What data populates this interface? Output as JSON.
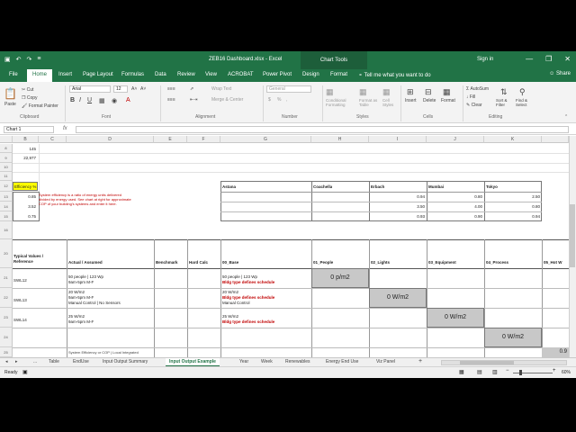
{
  "window": {
    "title": "ZEB16 Dashboard.xlsx - Excel",
    "context_tab": "Chart Tools",
    "sign_in": "Sign in",
    "controls": [
      "—",
      "❐",
      "✕"
    ]
  },
  "quick_access": [
    "▣",
    "↶",
    "↷",
    "≡"
  ],
  "ribbon_tabs": [
    "File",
    "Home",
    "Insert",
    "Page Layout",
    "Formulas",
    "Data",
    "Review",
    "View",
    "ACROBAT",
    "Power Pivot",
    "Design",
    "Format"
  ],
  "tell_me": "Tell me what you want to do",
  "share": "Share",
  "ribbon": {
    "clipboard": {
      "paste": "Paste",
      "cut": "Cut",
      "copy": "Copy",
      "format_painter": "Format Painter",
      "label": "Clipboard"
    },
    "font": {
      "name": "Arial",
      "size": "12",
      "bold": "B",
      "italic": "I",
      "underline": "U",
      "grow": "A˄",
      "shrink": "A˅",
      "label": "Font"
    },
    "alignment": {
      "wrap": "Wrap Text",
      "merge": "Merge & Center",
      "label": "Alignment"
    },
    "number": {
      "format": "General",
      "currency": "$",
      "percent": "%",
      "comma": ",",
      "label": "Number"
    },
    "styles": {
      "conditional": "Conditional Formatting",
      "format_table": "Format as Table",
      "cell_styles": "Cell Styles",
      "label": "Styles"
    },
    "cells": {
      "insert": "Insert",
      "delete": "Delete",
      "format": "Format",
      "label": "Cells"
    },
    "editing": {
      "autosum": "AutoSum",
      "fill": "Fill",
      "clear": "Clear",
      "sort": "Sort & Filter",
      "find": "Find & Select",
      "label": "Editing"
    }
  },
  "name_box": "Chart 1",
  "fx": "fx",
  "columns": [
    "B",
    "C",
    "D",
    "E",
    "F",
    "G",
    "H",
    "I",
    "J",
    "K"
  ],
  "rows": [
    "8",
    "9",
    "10",
    "11",
    "12",
    "13",
    "14",
    "15",
    "16",
    "20",
    "21",
    "22",
    "23",
    "24",
    "25"
  ],
  "cells": {
    "b8": "145",
    "b9": "22,977",
    "b12": "Efficiency %",
    "b13": "0.85",
    "b14": "3.52",
    "b15": "0.75",
    "note": [
      "System efficiency is a ratio of energy units delivered",
      "divided by energy used. See chart at right for approximate",
      "COP of your building's systems and enter it here."
    ],
    "locations": [
      "Astana",
      "Coachella",
      "Erbach",
      "Mumbai",
      "Tokyo"
    ],
    "loc_values": [
      [
        "0.94",
        "0.80",
        "2.50"
      ],
      [
        "3.50",
        "4.00",
        "0.80"
      ],
      [
        "0.93",
        "0.90",
        "0.94"
      ]
    ],
    "hdr_typical": [
      "Typical Values /",
      "Reference"
    ],
    "hdr_actual": "Actual / Assumed",
    "hdr_benchmark": "Benchmark",
    "hdr_hardcalc": "Hard Calc",
    "hdr_base": "00_Base",
    "hdr_people": "01_People",
    "hdr_lights": "02_Lights",
    "hdr_equipment": "03_Equipment",
    "hdr_process": "04_Process",
    "hdr_hotw": "05_Hot W",
    "r21_ref": "SWL12",
    "r21_actual": [
      "50 people | 123 Wp",
      "9am-5pm M-F"
    ],
    "r21_base": [
      "50 people | 123 Wp",
      "Bldg type defines schedule"
    ],
    "r21_val": "0 p/m2",
    "r22_ref": "SWL13",
    "r22_actual": [
      "20 W/m2",
      "9am-5pm M-F",
      "Manual Control | No Sensors"
    ],
    "r22_base": [
      "20 W/m2",
      "Bldg type defines schedule",
      "Manual Control"
    ],
    "r22_val": "0 W/m2",
    "r23_ref": "SWL14",
    "r23_actual": [
      "25 W/m2",
      "9am-5pm M-F"
    ],
    "r23_base": [
      "25 W/m2",
      "Bldg type defines schedule"
    ],
    "r23_val": "0 W/m2",
    "r24_val": "0 W/m2",
    "r25_partial": "System Efficiency or COP | Local Integrated",
    "r25_right": "0.9"
  },
  "sheet_nav": [
    "◂",
    "▸",
    "..."
  ],
  "sheets": [
    "Table",
    "EndUse",
    "Input Output Summary",
    "Input Output Example",
    "Year",
    "Week",
    "Renewables",
    "Energy End Use",
    "Viz Panel"
  ],
  "active_sheet": "Input Output Example",
  "add_sheet": "+",
  "status": {
    "ready": "Ready",
    "zoom": "60%"
  },
  "colors": {
    "excel_green": "#217346",
    "yellow": "#ffff00",
    "red_text": "#c00000",
    "gray_box": "#c8c8c8"
  }
}
